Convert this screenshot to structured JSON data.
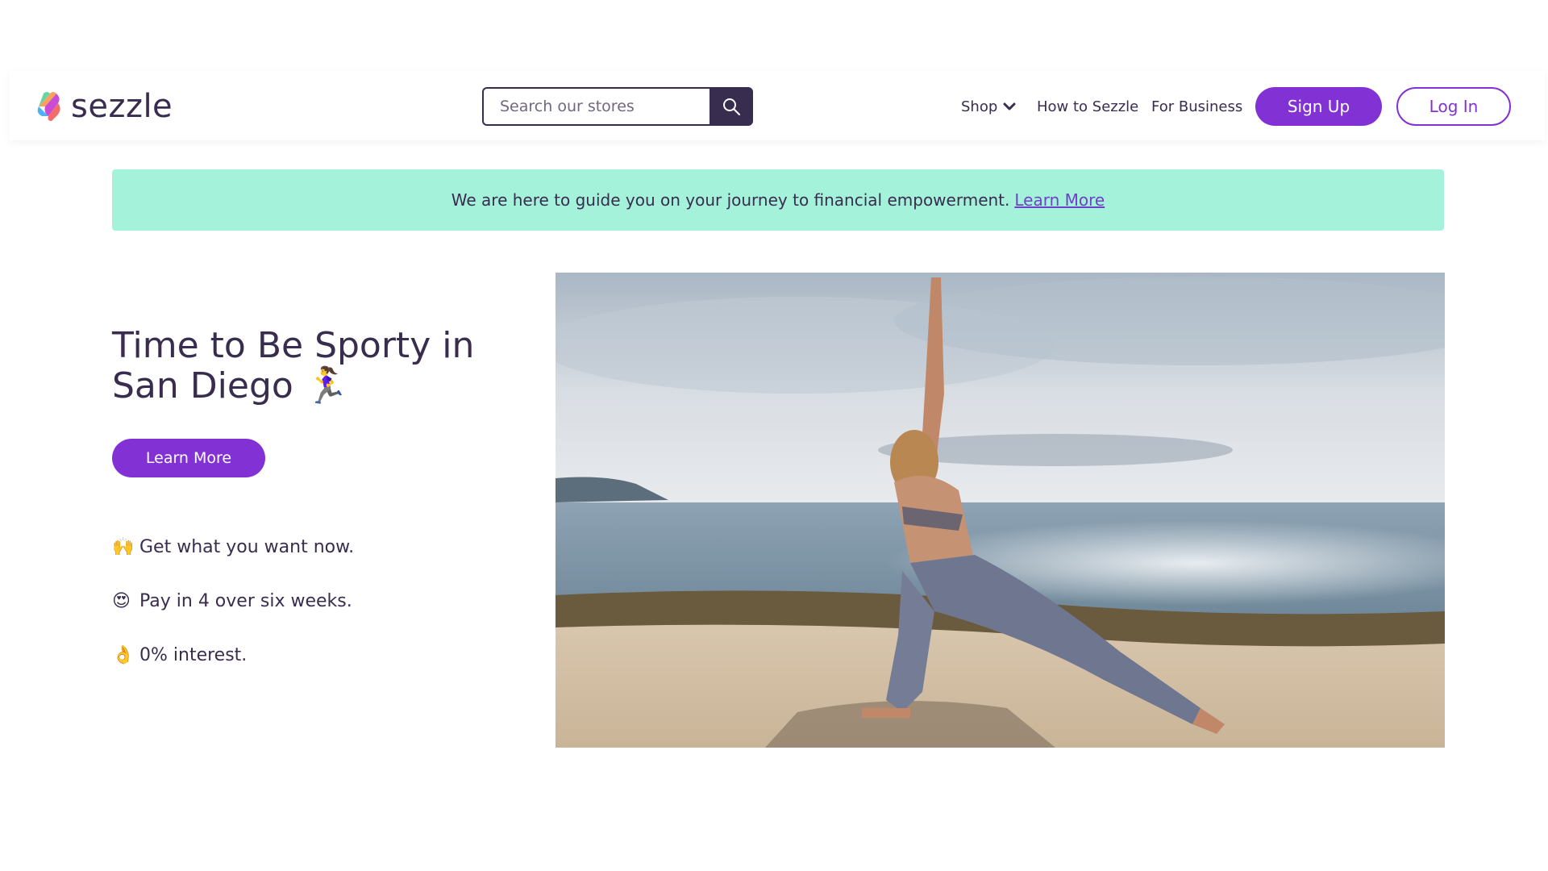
{
  "header": {
    "logo_text": "sezzle",
    "search": {
      "placeholder": "Search our stores",
      "value": ""
    },
    "nav": {
      "shop": "Shop",
      "how_to": "How to Sezzle",
      "for_business": "For Business"
    },
    "sign_up": "Sign Up",
    "log_in": "Log In"
  },
  "banner": {
    "text": "We are here to guide you on your journey to financial empowerment.",
    "link": "Learn More"
  },
  "hero": {
    "title": "Time to Be Sporty in San Diego 🏃‍♀️",
    "cta": "Learn More",
    "features": [
      {
        "emoji": "🙌",
        "text": "Get what you want now."
      },
      {
        "emoji": "😍",
        "text": "Pay in 4 over six weeks."
      },
      {
        "emoji": "👌",
        "text": "0% interest."
      }
    ]
  },
  "colors": {
    "brand_purple": "#8232d4",
    "dark_text": "#392d4f",
    "banner_mint": "#a3f2d9"
  }
}
